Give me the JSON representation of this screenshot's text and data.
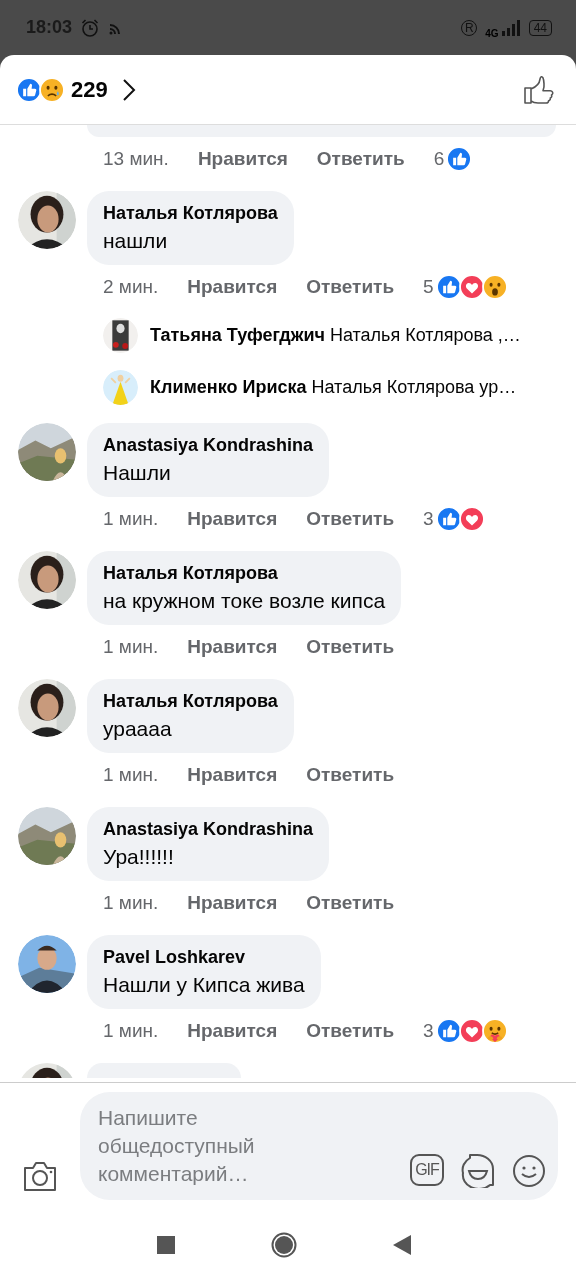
{
  "status_bar": {
    "time": "18:03",
    "roaming": "R",
    "network": "4G",
    "battery": "44"
  },
  "header": {
    "reactions": [
      {
        "kind": "like"
      },
      {
        "kind": "sad"
      }
    ],
    "count": "229"
  },
  "comments": [
    {
      "kind": "cut_above",
      "time": "13 мин.",
      "like": "Нравится",
      "reply": "Ответить",
      "count": "6",
      "reactions": [
        {
          "kind": "like"
        }
      ]
    },
    {
      "kind": "full",
      "author": "Наталья Котлярова",
      "text": "нашли",
      "time": "2 мин.",
      "like": "Нравится",
      "reply": "Ответить",
      "count": "5",
      "reactions": [
        {
          "kind": "like"
        },
        {
          "kind": "love"
        },
        {
          "kind": "wow"
        }
      ],
      "replies": [
        {
          "author": "Татьяна Туфегджич",
          "text": "Наталья Котлярова ,…"
        },
        {
          "author": "Клименко Ириска",
          "text": "Наталья Котлярова ур…"
        }
      ]
    },
    {
      "kind": "full",
      "author": "Anastasiya Kondrashina",
      "text": "Нашли",
      "time": "1 мин.",
      "like": "Нравится",
      "reply": "Ответить",
      "count": "3",
      "reactions": [
        {
          "kind": "like"
        },
        {
          "kind": "love"
        }
      ]
    },
    {
      "kind": "full",
      "author": "Наталья Котлярова",
      "text": "на кружном токе возле кипса",
      "time": "1 мин.",
      "like": "Нравится",
      "reply": "Ответить"
    },
    {
      "kind": "full",
      "author": "Наталья Котлярова",
      "text": "ураааа",
      "time": "1 мин.",
      "like": "Нравится",
      "reply": "Ответить"
    },
    {
      "kind": "full",
      "author": "Anastasiya Kondrashina",
      "text": "Ура!!!!!!",
      "time": "1 мин.",
      "like": "Нравится",
      "reply": "Ответить"
    },
    {
      "kind": "full",
      "author": "Pavel Loshkarev",
      "text": "Нашли у Кипса жива",
      "time": "1 мин.",
      "like": "Нравится",
      "reply": "Ответить",
      "count": "3",
      "reactions": [
        {
          "kind": "like"
        },
        {
          "kind": "love"
        },
        {
          "kind": "care"
        }
      ]
    },
    {
      "kind": "cut_below"
    }
  ],
  "composer": {
    "placeholder": "Напишите общедоступный комментарий…",
    "gif": "GIF"
  }
}
